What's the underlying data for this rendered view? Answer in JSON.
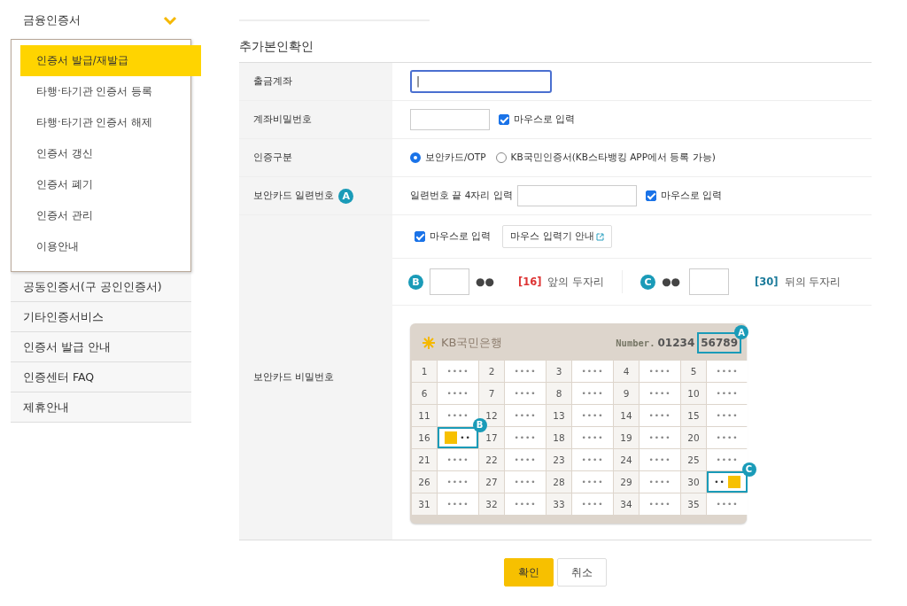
{
  "sidebar": {
    "heading": "금융인증서",
    "expanded": true,
    "submenu": [
      {
        "label": "인증서 발급/재발급",
        "selected": true
      },
      {
        "label": "타행·타기관 인증서 등록",
        "selected": false
      },
      {
        "label": "타행·타기관 인증서 해제",
        "selected": false
      },
      {
        "label": "인증서 갱신",
        "selected": false
      },
      {
        "label": "인증서 폐기",
        "selected": false
      },
      {
        "label": "인증서 관리",
        "selected": false
      },
      {
        "label": "이용안내",
        "selected": false
      }
    ],
    "items": [
      {
        "label": "공동인증서(구 공인인증서)"
      },
      {
        "label": "기타인증서비스"
      },
      {
        "label": "인증서 발급 안내"
      },
      {
        "label": "인증센터 FAQ"
      },
      {
        "label": "제휴안내"
      }
    ]
  },
  "section_title": "추가본인확인",
  "form": {
    "account": {
      "label": "출금계좌",
      "value": "|"
    },
    "password": {
      "label": "계좌비밀번호",
      "mouse_input": {
        "label": "마우스로 입력",
        "checked": true
      }
    },
    "auth_type": {
      "label": "인증구분",
      "options": [
        {
          "label": "보안카드/OTP",
          "selected": true
        },
        {
          "label": "KB국민인증서(KB스타뱅킹 APP에서 등록 가능)",
          "selected": false
        }
      ]
    },
    "serial": {
      "label": "보안카드 일련번호",
      "badge": "A",
      "hint": "일련번호 끝 4자리 입력",
      "mouse_input": {
        "label": "마우스로 입력",
        "checked": true
      }
    },
    "card_password": {
      "label": "보안카드 비밀번호",
      "mouse_input": {
        "label": "마우스로 입력",
        "checked": true
      },
      "guide_button": "마우스 입력기 안내",
      "front": {
        "badge": "B",
        "dots": "●●",
        "index": "[16]",
        "text": "앞의 두자리"
      },
      "back": {
        "badge": "C",
        "dots": "●●",
        "index": "[30]",
        "text": "뒤의 두자리"
      },
      "card": {
        "bank": "KB국민은행",
        "number_label": "Number.",
        "number_plain": "01234",
        "number_marked": "56789",
        "badges": [
          "A",
          "B",
          "C"
        ],
        "rows": [
          [
            {
              "no": "1",
              "mask": "••••",
              "kind": "plain"
            },
            {
              "no": "2",
              "mask": "••••",
              "kind": "plain"
            },
            {
              "no": "3",
              "mask": "••••",
              "kind": "plain"
            },
            {
              "no": "4",
              "mask": "••••",
              "kind": "plain"
            },
            {
              "no": "5",
              "mask": "••••",
              "kind": "plain"
            }
          ],
          [
            {
              "no": "6",
              "mask": "••••",
              "kind": "plain"
            },
            {
              "no": "7",
              "mask": "••••",
              "kind": "plain"
            },
            {
              "no": "8",
              "mask": "••••",
              "kind": "plain"
            },
            {
              "no": "9",
              "mask": "••••",
              "kind": "plain"
            },
            {
              "no": "10",
              "mask": "••••",
              "kind": "plain"
            }
          ],
          [
            {
              "no": "11",
              "mask": "••••",
              "kind": "plain"
            },
            {
              "no": "12",
              "mask": "••••",
              "kind": "plain"
            },
            {
              "no": "13",
              "mask": "••••",
              "kind": "plain"
            },
            {
              "no": "14",
              "mask": "••••",
              "kind": "plain"
            },
            {
              "no": "15",
              "mask": "••••",
              "kind": "plain"
            }
          ],
          [
            {
              "no": "16",
              "mask": "••",
              "kind": "front"
            },
            {
              "no": "17",
              "mask": "••••",
              "kind": "plain"
            },
            {
              "no": "18",
              "mask": "••••",
              "kind": "plain"
            },
            {
              "no": "19",
              "mask": "••••",
              "kind": "plain"
            },
            {
              "no": "20",
              "mask": "••••",
              "kind": "plain"
            }
          ],
          [
            {
              "no": "21",
              "mask": "••••",
              "kind": "plain"
            },
            {
              "no": "22",
              "mask": "••••",
              "kind": "plain"
            },
            {
              "no": "23",
              "mask": "••••",
              "kind": "plain"
            },
            {
              "no": "24",
              "mask": "••••",
              "kind": "plain"
            },
            {
              "no": "25",
              "mask": "••••",
              "kind": "plain"
            }
          ],
          [
            {
              "no": "26",
              "mask": "••••",
              "kind": "plain"
            },
            {
              "no": "27",
              "mask": "••••",
              "kind": "plain"
            },
            {
              "no": "28",
              "mask": "••••",
              "kind": "plain"
            },
            {
              "no": "29",
              "mask": "••••",
              "kind": "plain"
            },
            {
              "no": "30",
              "mask": "••",
              "kind": "back"
            }
          ],
          [
            {
              "no": "31",
              "mask": "••••",
              "kind": "plain"
            },
            {
              "no": "32",
              "mask": "••••",
              "kind": "plain"
            },
            {
              "no": "33",
              "mask": "••••",
              "kind": "plain"
            },
            {
              "no": "34",
              "mask": "••••",
              "kind": "plain"
            },
            {
              "no": "35",
              "mask": "••••",
              "kind": "plain"
            }
          ]
        ]
      }
    }
  },
  "buttons": [
    {
      "label": "확인",
      "kind": "primary"
    },
    {
      "label": "취소",
      "kind": "secondary"
    }
  ]
}
